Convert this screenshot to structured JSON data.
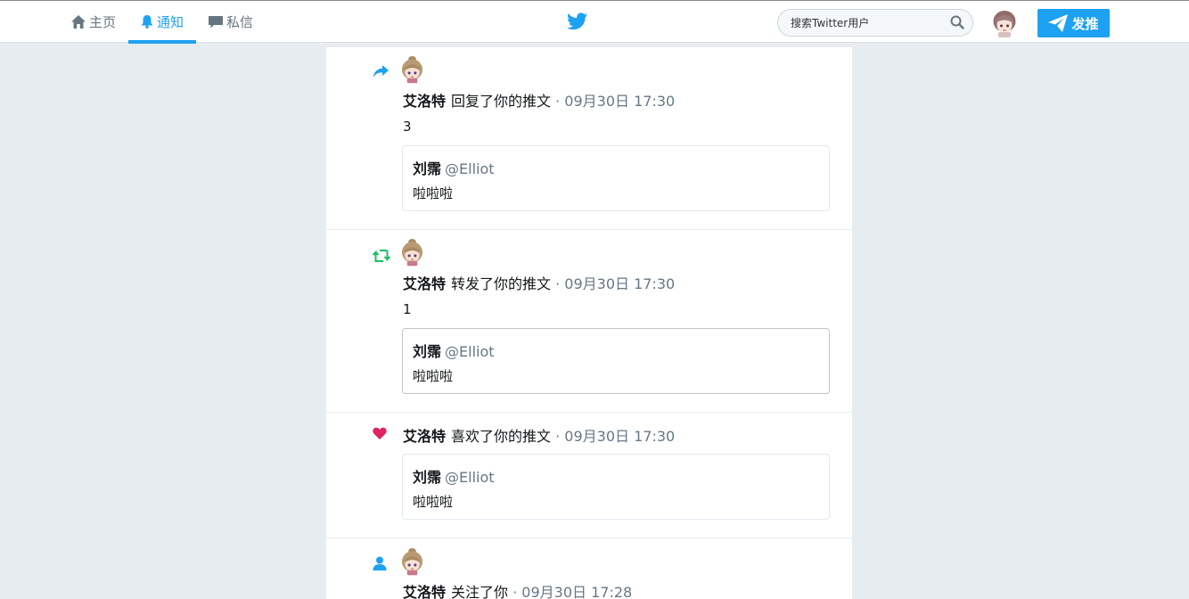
{
  "nav": {
    "home": "主页",
    "notifications": "通知",
    "messages": "私信"
  },
  "search": {
    "placeholder": "搜索Twitter用户"
  },
  "tweet_button": "发推",
  "colors": {
    "accent": "#1da1f2",
    "retweet": "#17bf63",
    "like": "#e0245e",
    "muted": "#657786"
  },
  "notifications": [
    {
      "type": "reply",
      "icon": "reply-icon",
      "name": "艾洛特",
      "action": "回复了你的推文",
      "time": "· 09月30日 17:30",
      "text": "3",
      "quote": {
        "name": "刘霈",
        "handle": "@Elliot",
        "text": "啦啦啦"
      }
    },
    {
      "type": "retweet",
      "icon": "retweet-icon",
      "name": "艾洛特",
      "action": "转发了你的推文",
      "time": "· 09月30日 17:30",
      "text": "1",
      "quote": {
        "name": "刘霈",
        "handle": "@Elliot",
        "text": "啦啦啦"
      }
    },
    {
      "type": "like",
      "icon": "heart-icon",
      "name": "艾洛特",
      "action": "喜欢了你的推文",
      "time": "· 09月30日 17:30",
      "quote": {
        "name": "刘霈",
        "handle": "@Elliot",
        "text": "啦啦啦"
      }
    },
    {
      "type": "follow",
      "icon": "person-icon",
      "name": "艾洛特",
      "action": "关注了你",
      "time": "· 09月30日 17:28"
    }
  ]
}
